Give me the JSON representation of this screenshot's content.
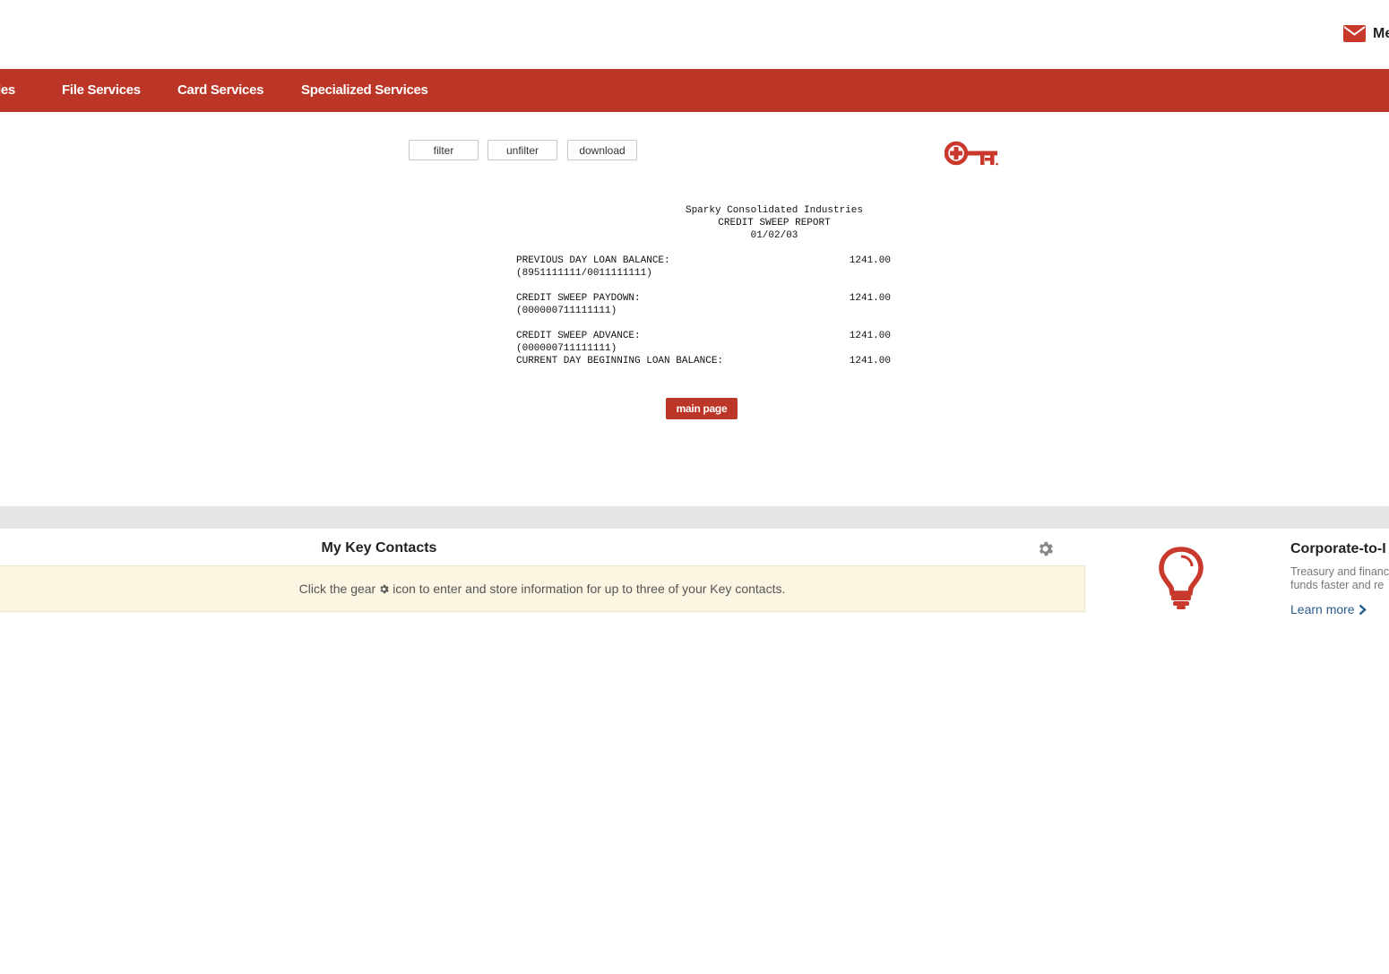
{
  "header": {
    "mail_label": "Me"
  },
  "nav": {
    "items": [
      {
        "label": "les"
      },
      {
        "label": "File Services"
      },
      {
        "label": "Card Services"
      },
      {
        "label": "Specialized Services"
      }
    ]
  },
  "toolbar": {
    "filter": "filter",
    "unfilter": "unfilter",
    "download": "download"
  },
  "report": {
    "company": "Sparky Consolidated Industries",
    "title": "CREDIT SWEEP REPORT",
    "date": "01/02/03",
    "rows": [
      {
        "label": "PREVIOUS DAY LOAN BALANCE:",
        "account": "(8951111111/0011111111)",
        "amount": "1241.00"
      },
      {
        "label": "CREDIT SWEEP PAYDOWN:",
        "account": "(000000711111111)",
        "amount": "1241.00"
      },
      {
        "label": "CREDIT SWEEP ADVANCE:",
        "account": "(000000711111111)",
        "amount": "1241.00"
      },
      {
        "label": "CURRENT DAY BEGINNING LOAN BALANCE:",
        "amount": "1241.00"
      }
    ]
  },
  "main_page_button": "main page",
  "contacts": {
    "title": "My Key Contacts",
    "notice_before": "Click the gear",
    "notice_after": "icon to enter and store information for up to three of your Key contacts."
  },
  "promo": {
    "title": "Corporate-to-I",
    "body_line1": "Treasury and financ",
    "body_line2": "funds faster and re",
    "link": "Learn more"
  },
  "colors": {
    "brand_red": "#bb3626",
    "notice_bg": "#fbf5e1",
    "link_blue": "#2b5d8c"
  }
}
